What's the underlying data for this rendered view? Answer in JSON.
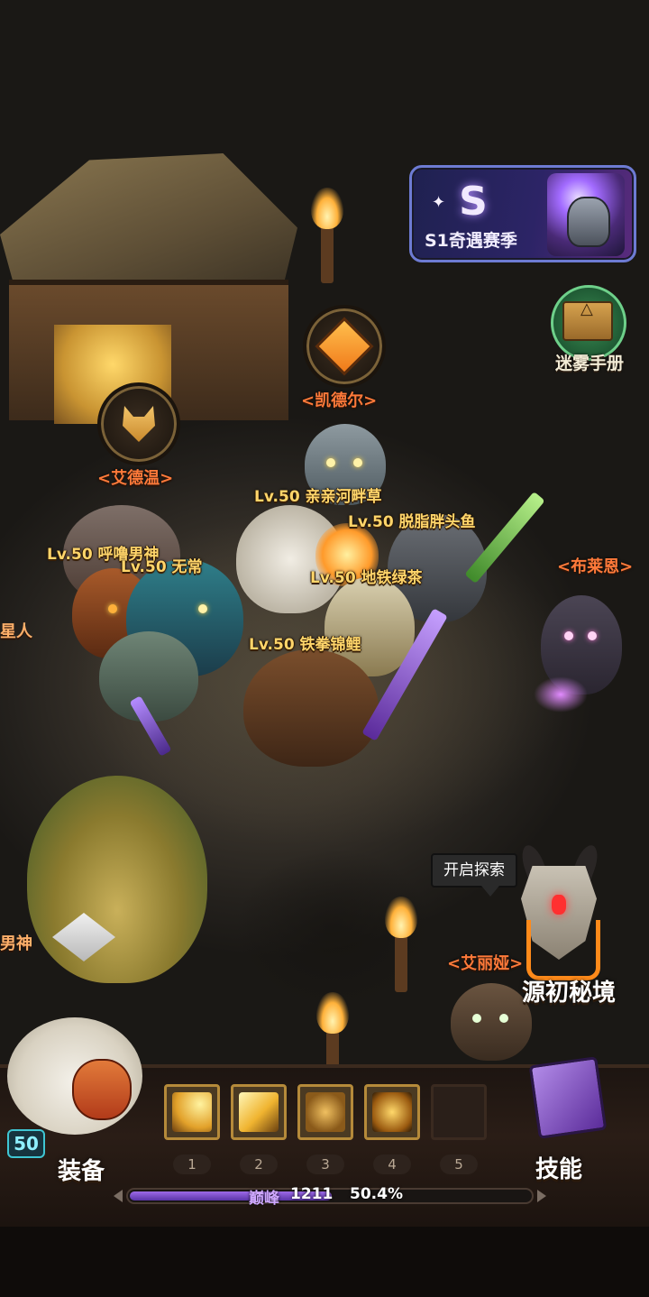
{
  "season": {
    "label": "S1奇遇赛季",
    "badge": "S"
  },
  "handbook": {
    "label": "迷雾手册"
  },
  "npcs": {
    "kaideer": "<凯德尔>",
    "aidewen": "<艾德温>",
    "bulaien": "<布莱恩>",
    "ailiya": "<艾丽娅>"
  },
  "side_labels": {
    "left_star": "星人",
    "left_god": "男神"
  },
  "players": [
    {
      "name": "Lv.50 亲亲河畔草"
    },
    {
      "name": "Lv.50 脱脂胖头鱼"
    },
    {
      "name": "Lv.50 呼噜男神"
    },
    {
      "name": "Lv.50 无常"
    },
    {
      "name": "Lv.50 地铁绿茶"
    },
    {
      "name": "Lv.50 铁拳锦鲤"
    }
  ],
  "explore": {
    "tip": "开启探索",
    "realm_label": "源初秘境"
  },
  "hud": {
    "level": "50",
    "equip_label": "装备",
    "skill_label": "技能",
    "slots": [
      "1",
      "2",
      "3",
      "4",
      "5"
    ],
    "rank_label": "巅峰",
    "rank_value": "1211",
    "progress_text": "50.4%",
    "progress_fraction": 0.504
  },
  "colors": {
    "npc_name": "#ff7a3a",
    "player_name": "#ffd56a",
    "xp_fill": "#9d6ae8",
    "season_border": "#6d7bd3"
  }
}
